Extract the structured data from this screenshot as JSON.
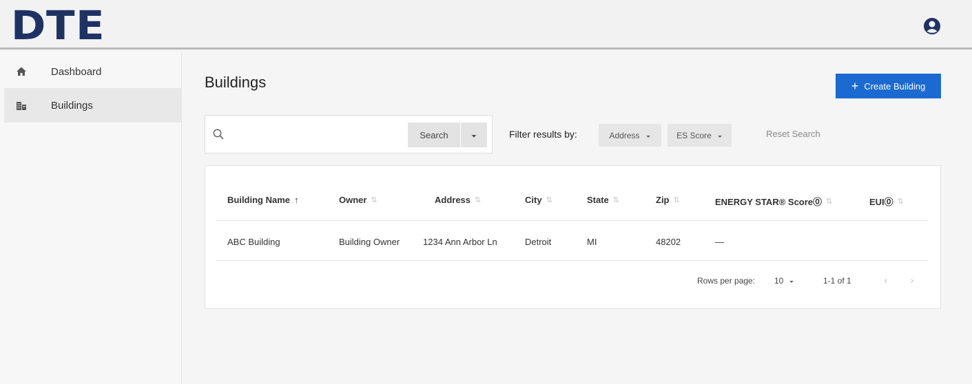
{
  "header": {
    "logo_letters": [
      "D",
      "T",
      "E"
    ],
    "account_icon": "user-circle-icon",
    "brand_color": "#1e3264"
  },
  "sidebar": {
    "items": [
      {
        "label": "Dashboard",
        "icon": "home-icon",
        "active": false
      },
      {
        "label": "Buildings",
        "icon": "buildings-icon",
        "active": true
      }
    ]
  },
  "main": {
    "title": "Buildings",
    "create_button": {
      "icon": "+",
      "label": "Create Building",
      "color": "#1a6ad1"
    },
    "search": {
      "placeholder": "",
      "button_label": "Search"
    },
    "filter": {
      "label": "Filter results by:",
      "chips": [
        "Address",
        "ES Score"
      ],
      "reset_label": "Reset Search"
    },
    "table": {
      "columns": [
        {
          "label": "Building Name",
          "sort": "↑",
          "sorted": true
        },
        {
          "label": "Owner",
          "sort": "⇅",
          "sorted": false
        },
        {
          "label": "Address",
          "sort": "⇅",
          "sorted": false
        },
        {
          "label": "City",
          "sort": "⇅",
          "sorted": false
        },
        {
          "label": "State",
          "sort": "⇅",
          "sorted": false
        },
        {
          "label": "Zip",
          "sort": "⇅",
          "sorted": false
        },
        {
          "label": "ENERGY STAR® Score⓪",
          "sort": "⇅",
          "sorted": false
        },
        {
          "label": "EUI⓪",
          "sort": "⇅",
          "sorted": false
        }
      ],
      "rows": [
        [
          "ABC Building",
          "Building Owner",
          "1234 Ann Arbor Ln",
          "Detroit",
          "MI",
          "48202",
          "—",
          ""
        ]
      ]
    },
    "pagination": {
      "rows_per_page_label": "Rows per page:",
      "rows_per_page_value": "10",
      "range": "1-1 of 1",
      "prev": "‹",
      "next": "›"
    }
  }
}
